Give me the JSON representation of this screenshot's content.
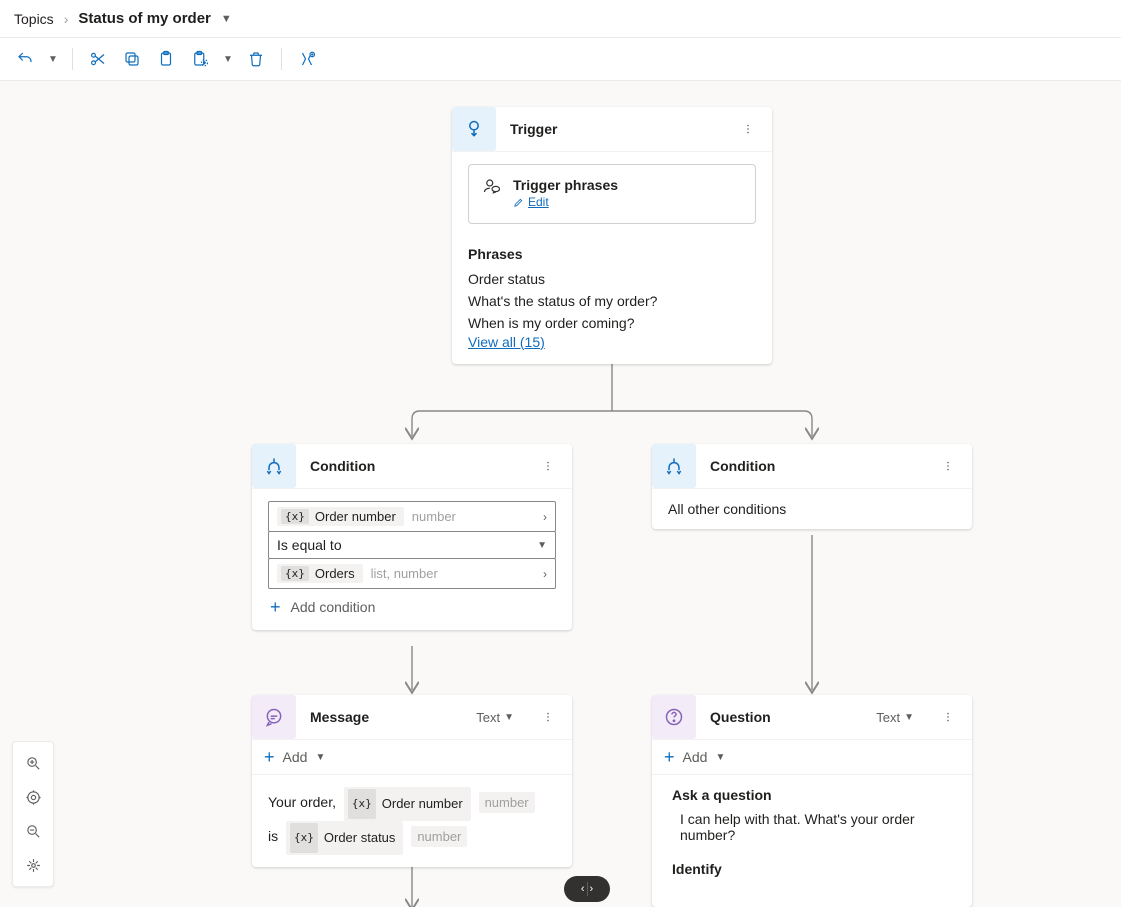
{
  "breadcrumb": {
    "root": "Topics",
    "title": "Status of my order"
  },
  "nodes": {
    "trigger": {
      "title": "Trigger",
      "section_title": "Trigger phrases",
      "edit": "Edit",
      "phrases_label": "Phrases",
      "phrases": [
        "Order status",
        "What's the status of my order?",
        "When is my order coming?"
      ],
      "view_all": "View all (15)"
    },
    "condition_left": {
      "title": "Condition",
      "var1": {
        "name": "Order number",
        "type": "number"
      },
      "operator": "Is equal to",
      "var2": {
        "name": "Orders",
        "type": "list, number"
      },
      "add": "Add condition"
    },
    "condition_right": {
      "title": "Condition",
      "text": "All other conditions"
    },
    "message": {
      "title": "Message",
      "tag": "Text",
      "add": "Add",
      "line1_prefix": "Your order,",
      "var1": {
        "name": "Order number",
        "type": "number"
      },
      "line2_prefix": "is",
      "var2": {
        "name": "Order status",
        "type": "number"
      }
    },
    "question": {
      "title": "Question",
      "tag": "Text",
      "add": "Add",
      "ask_label": "Ask a question",
      "ask_text": "I can help with that. What's your order number?",
      "identify_label": "Identify"
    }
  }
}
